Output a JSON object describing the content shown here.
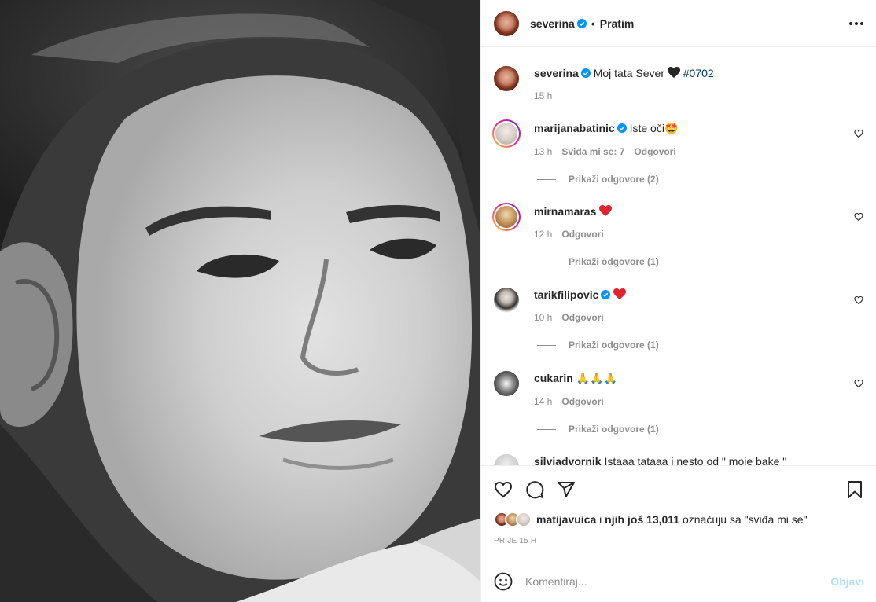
{
  "photo": {
    "alt_icon": "portrait-photo"
  },
  "header": {
    "username": "severina",
    "separator": "•",
    "follow_label": "Pratim"
  },
  "caption": {
    "username": "severina",
    "text": "Moj tata Sever",
    "hashtag": "#0702",
    "time": "15 h"
  },
  "comments": [
    {
      "username": "marijanabatinic",
      "verified": true,
      "text": "Iste oči",
      "emoji": "🤩",
      "time": "13 h",
      "likes": "Sviđa mi se: 7",
      "reply": "Odgovori",
      "view_replies": "Prikaži odgovore (2)"
    },
    {
      "username": "mirnamaras",
      "verified": false,
      "text": "",
      "emoji": "heart",
      "time": "12 h",
      "likes": "",
      "reply": "Odgovori",
      "view_replies": "Prikaži odgovore (1)"
    },
    {
      "username": "tarikfilipovic",
      "verified": true,
      "text": "",
      "emoji": "heart",
      "time": "10 h",
      "likes": "",
      "reply": "Odgovori",
      "view_replies": "Prikaži odgovore (1)"
    },
    {
      "username": "cukarin",
      "verified": false,
      "text": "",
      "emoji": "🙏🙏🙏",
      "time": "14 h",
      "likes": "",
      "reply": "Odgovori",
      "view_replies": "Prikaži odgovore (1)"
    },
    {
      "username": "silviadvornik",
      "verified": false,
      "text": "Istaaa tataaa i nesto od \" moje bake \"",
      "emoji": "",
      "time": "",
      "likes": "",
      "reply": "",
      "view_replies": ""
    }
  ],
  "likes": {
    "user": "matijavuica",
    "connector": " i ",
    "others": "njih još 13,011",
    "suffix": " označuju sa \"sviđa mi se\""
  },
  "posted_ago": "PRIJE 15 H",
  "add_comment": {
    "placeholder": "Komentiraj...",
    "post_label": "Objavi"
  },
  "colors": {
    "verified": "#0095f6",
    "heart": "#ed4956",
    "link": "#00376b",
    "post_disabled": "#b2dffc"
  }
}
